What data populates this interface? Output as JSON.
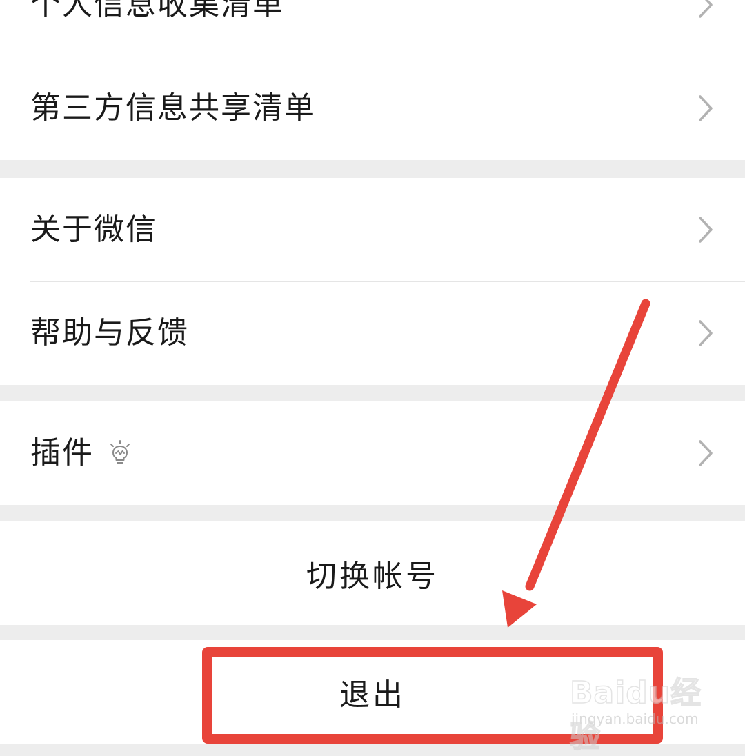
{
  "settings": {
    "group1": [
      {
        "label": "个人信息收集清单",
        "chevron": "chevron-right-icon"
      },
      {
        "label": "第三方信息共享清单",
        "chevron": "chevron-right-icon"
      }
    ],
    "group2": [
      {
        "label": "关于微信",
        "chevron": "chevron-right-icon"
      },
      {
        "label": "帮助与反馈",
        "chevron": "chevron-right-icon"
      }
    ],
    "group3": [
      {
        "label": "插件",
        "icon": "lightbulb-icon",
        "chevron": "chevron-right-icon"
      }
    ],
    "switch_account": "切换帐号",
    "logout": "退出"
  },
  "annotation": {
    "color": "#e8443a"
  },
  "watermark": {
    "brand": "Baidu经验",
    "url": "jingyan.baidu.com"
  },
  "colors": {
    "background": "#ededed",
    "row_background": "#ffffff",
    "divider": "#e5e5e5",
    "chevron": "#b2b2b2"
  }
}
